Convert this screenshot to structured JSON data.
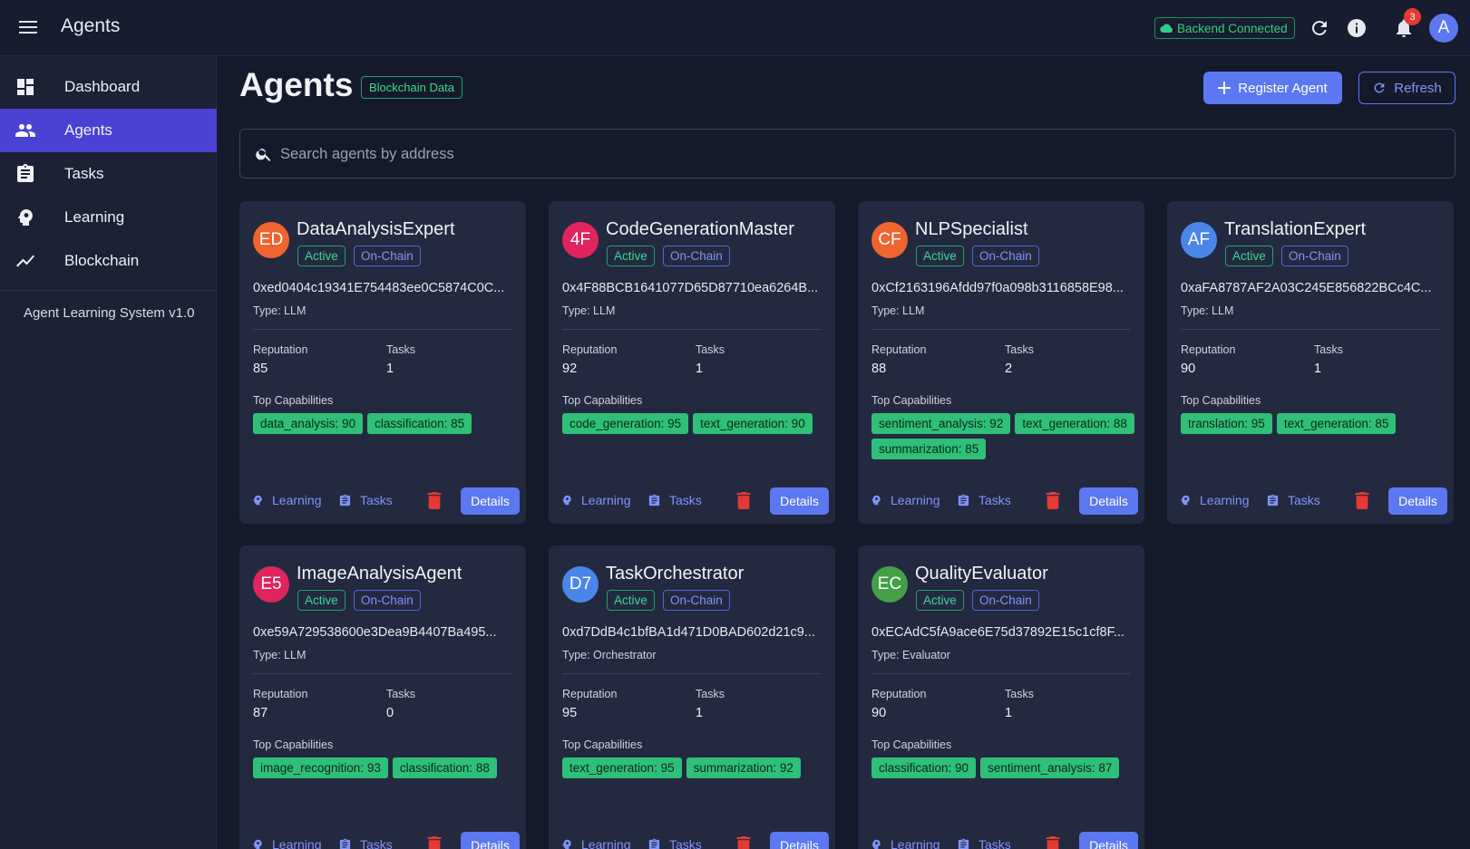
{
  "header": {
    "title": "Agents",
    "backend_status": "Backend Connected",
    "notifications_count": "3",
    "user_initial": "A"
  },
  "sidebar": {
    "items": [
      {
        "label": "Dashboard",
        "icon": "dashboard-icon"
      },
      {
        "label": "Agents",
        "icon": "people-icon",
        "active": true
      },
      {
        "label": "Tasks",
        "icon": "clipboard-icon"
      },
      {
        "label": "Learning",
        "icon": "brain-icon"
      },
      {
        "label": "Blockchain",
        "icon": "trend-icon"
      }
    ],
    "version": "Agent Learning System v1.0"
  },
  "main": {
    "title": "Agents",
    "data_badge": "Blockchain Data",
    "register_label": "Register Agent",
    "refresh_label": "Refresh",
    "search_placeholder": "Search agents by address"
  },
  "labels": {
    "active": "Active",
    "on_chain": "On-Chain",
    "reputation": "Reputation",
    "tasks": "Tasks",
    "top_capabilities": "Top Capabilities",
    "learning": "Learning",
    "tasks_action": "Tasks",
    "details": "Details"
  },
  "colors": {
    "accent": "#5b78f0",
    "active_nav": "#4a42d4",
    "capability": "#2fbf78",
    "delete": "#e53935"
  },
  "agents": [
    {
      "initials": "ED",
      "avatar_color": "#f06430",
      "name": "DataAnalysisExpert",
      "address": "0xed0404c19341E754483ee0C5874C0C...",
      "type": "Type: LLM",
      "reputation": "85",
      "tasks": "1",
      "capabilities": [
        "data_analysis: 90",
        "classification: 85"
      ]
    },
    {
      "initials": "4F",
      "avatar_color": "#e0245e",
      "name": "CodeGenerationMaster",
      "address": "0x4F88BCB1641077D65D87710ea6264B...",
      "type": "Type: LLM",
      "reputation": "92",
      "tasks": "1",
      "capabilities": [
        "code_generation: 95",
        "text_generation: 90"
      ]
    },
    {
      "initials": "CF",
      "avatar_color": "#f06430",
      "name": "NLPSpecialist",
      "address": "0xCf2163196Afdd97f0a098b3116858E98...",
      "type": "Type: LLM",
      "reputation": "88",
      "tasks": "2",
      "capabilities": [
        "sentiment_analysis: 92",
        "text_generation: 88",
        "summarization: 85"
      ]
    },
    {
      "initials": "AF",
      "avatar_color": "#4a86e8",
      "name": "TranslationExpert",
      "address": "0xaFA8787AF2A03C245E856822BCc4C...",
      "type": "Type: LLM",
      "reputation": "90",
      "tasks": "1",
      "capabilities": [
        "translation: 95",
        "text_generation: 85"
      ]
    },
    {
      "initials": "E5",
      "avatar_color": "#e0245e",
      "name": "ImageAnalysisAgent",
      "address": "0xe59A729538600e3Dea9B4407Ba495...",
      "type": "Type: LLM",
      "reputation": "87",
      "tasks": "0",
      "capabilities": [
        "image_recognition: 93",
        "classification: 88"
      ]
    },
    {
      "initials": "D7",
      "avatar_color": "#4a86e8",
      "name": "TaskOrchestrator",
      "address": "0xd7DdB4c1bfBA1d471D0BAD602d21c9...",
      "type": "Type: Orchestrator",
      "reputation": "95",
      "tasks": "1",
      "capabilities": [
        "text_generation: 95",
        "summarization: 92"
      ]
    },
    {
      "initials": "EC",
      "avatar_color": "#43a047",
      "name": "QualityEvaluator",
      "address": "0xECAdC5fA9ace6E75d37892E15c1cf8F...",
      "type": "Type: Evaluator",
      "reputation": "90",
      "tasks": "1",
      "capabilities": [
        "classification: 90",
        "sentiment_analysis: 87"
      ]
    }
  ]
}
